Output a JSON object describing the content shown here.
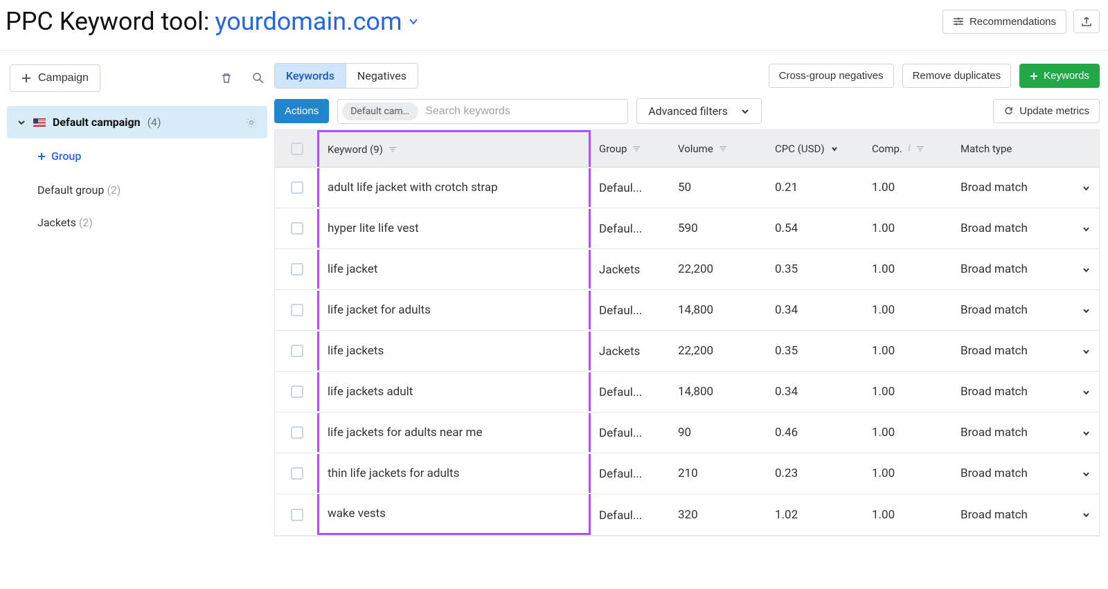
{
  "header": {
    "title": "PPC Keyword tool:",
    "domain": "yourdomain.com",
    "recommendations_label": "Recommendations"
  },
  "sidebar": {
    "campaign_button": "Campaign",
    "campaign": {
      "name": "Default campaign",
      "count": "(4)"
    },
    "group_add": "Group",
    "groups": [
      {
        "name": "Default group",
        "count": "(2)"
      },
      {
        "name": "Jackets",
        "count": "(2)"
      }
    ]
  },
  "toolbar": {
    "tabs": {
      "keywords": "Keywords",
      "negatives": "Negatives"
    },
    "cross_group": "Cross-group negatives",
    "remove_dup": "Remove duplicates",
    "add_keywords": "Keywords",
    "actions": "Actions",
    "chip": "Default campa",
    "search_placeholder": "Search keywords",
    "advanced_filters": "Advanced filters",
    "update_metrics": "Update metrics"
  },
  "table": {
    "headers": {
      "keyword": "Keyword (9)",
      "group": "Group",
      "volume": "Volume",
      "cpc": "CPC (USD)",
      "comp": "Comp.",
      "match": "Match type"
    },
    "rows": [
      {
        "keyword": "adult life jacket with crotch strap",
        "group": "Defaul...",
        "volume": "50",
        "cpc": "0.21",
        "comp": "1.00",
        "match": "Broad match"
      },
      {
        "keyword": "hyper lite life vest",
        "group": "Defaul...",
        "volume": "590",
        "cpc": "0.54",
        "comp": "1.00",
        "match": "Broad match"
      },
      {
        "keyword": "life jacket",
        "group": "Jackets",
        "volume": "22,200",
        "cpc": "0.35",
        "comp": "1.00",
        "match": "Broad match"
      },
      {
        "keyword": "life jacket for adults",
        "group": "Defaul...",
        "volume": "14,800",
        "cpc": "0.34",
        "comp": "1.00",
        "match": "Broad match"
      },
      {
        "keyword": "life jackets",
        "group": "Jackets",
        "volume": "22,200",
        "cpc": "0.35",
        "comp": "1.00",
        "match": "Broad match"
      },
      {
        "keyword": "life jackets adult",
        "group": "Defaul...",
        "volume": "14,800",
        "cpc": "0.34",
        "comp": "1.00",
        "match": "Broad match"
      },
      {
        "keyword": "life jackets for adults near me",
        "group": "Defaul...",
        "volume": "90",
        "cpc": "0.46",
        "comp": "1.00",
        "match": "Broad match"
      },
      {
        "keyword": "thin life jackets for adults",
        "group": "Defaul...",
        "volume": "210",
        "cpc": "0.23",
        "comp": "1.00",
        "match": "Broad match"
      },
      {
        "keyword": "wake vests",
        "group": "Defaul...",
        "volume": "320",
        "cpc": "1.02",
        "comp": "1.00",
        "match": "Broad match"
      }
    ]
  }
}
